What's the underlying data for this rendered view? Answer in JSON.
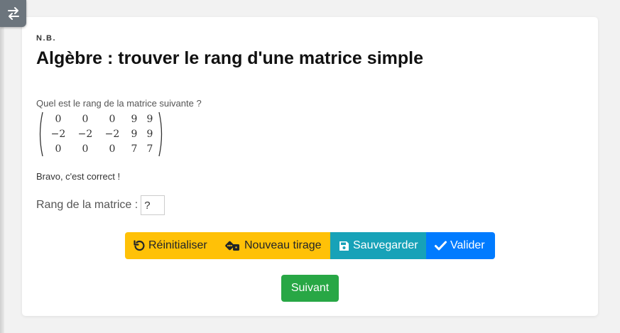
{
  "side_toggle": {
    "icon": "swap-arrows-icon"
  },
  "header": {
    "eyebrow": "N.B.",
    "title": "Algèbre : trouver le rang d'une matrice simple"
  },
  "exercise": {
    "question": "Quel est le rang de la matrice suivante ?",
    "matrix": [
      [
        "0",
        "0",
        "0",
        "9",
        "9"
      ],
      [
        "−2",
        "−2",
        "−2",
        "9",
        "9"
      ],
      [
        "0",
        "0",
        "0",
        "7",
        "7"
      ]
    ],
    "feedback": "Bravo, c'est correct !",
    "rank_label": "Rang de la matrice :",
    "rank_placeholder": "?"
  },
  "actions": {
    "reset": {
      "label": "Réinitialiser",
      "icon": "undo-icon"
    },
    "new_draw": {
      "label": "Nouveau tirage",
      "icon": "dice-icon"
    },
    "save": {
      "label": "Sauvegarder",
      "icon": "floppy-disk-icon"
    },
    "validate": {
      "label": "Valider",
      "icon": "checkmark-icon"
    },
    "next": {
      "label": "Suivant"
    }
  },
  "colors": {
    "warning": "#ffc107",
    "info": "#17a2b8",
    "primary": "#007bff",
    "success": "#28a745"
  }
}
